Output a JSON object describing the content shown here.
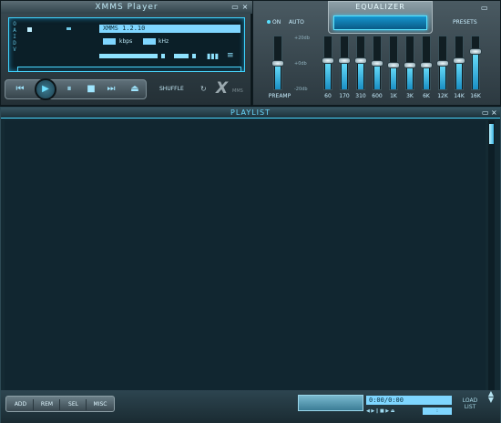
{
  "main": {
    "title": "XMMS Player",
    "song_title": "XMMS 1.2.10",
    "kbps_label": "kbps",
    "khz_label": "kHz",
    "vis_side_label": "O A I D V",
    "minimize": "▭",
    "close": "×",
    "transport": {
      "prev": "⏮",
      "play": "▶",
      "pause": "⏸",
      "stop": "■",
      "next": "⏭",
      "eject": "⏏"
    },
    "shuffle_label": "SHUFFLE",
    "repeat_icon": "↻",
    "logo": "X",
    "logo_small": "MMS"
  },
  "equalizer": {
    "title": "EQUALIZER",
    "on_label": "ON",
    "auto_label": "AUTO",
    "presets_label": "PRESETS",
    "minimize": "▭",
    "db_top": "+20db",
    "db_mid": "+0db",
    "db_bot": "-20db",
    "preamp_label": "PREAMP",
    "bands": [
      "60",
      "170",
      "310",
      "600",
      "1K",
      "3K",
      "6K",
      "12K",
      "14K",
      "16K"
    ],
    "levels": [
      0.55,
      0.55,
      0.55,
      0.5,
      0.45,
      0.45,
      0.45,
      0.5,
      0.55,
      0.75
    ],
    "preamp_level": 0.5,
    "accent_color": "#3dd3ff"
  },
  "playlist": {
    "title": "PLAYLIST",
    "minimize": "▭",
    "close": "×",
    "buttons": [
      "ADD",
      "REM",
      "SEL",
      "MISC"
    ],
    "time": "0:00/0:00",
    "load_list_line1": "LOAD",
    "load_list_line2": "LIST",
    "mini_controls": "◀ ▶ ‖ ■ ▶ ⏏",
    "mini_box": ":"
  }
}
